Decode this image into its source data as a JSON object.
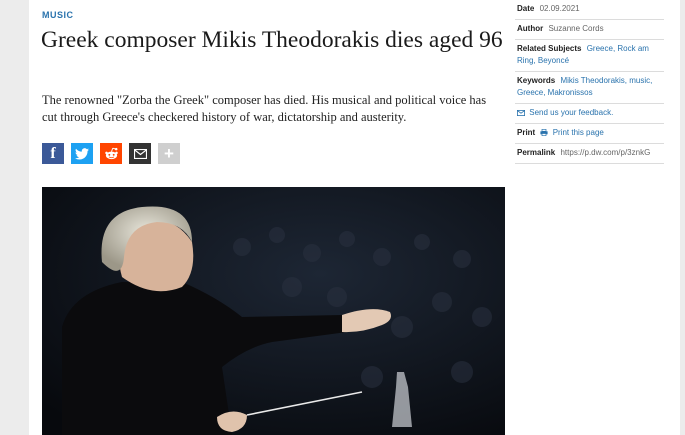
{
  "article": {
    "category": "MUSIC",
    "headline": "Greek composer Mikis Theodorakis dies aged 96",
    "teaser": "The renowned \"Zorba the Greek\" composer has died. His musical and political voice has cut through Greece's checkered history of war, dictatorship and austerity."
  },
  "share": [
    {
      "name": "facebook",
      "glyph": "f",
      "color": "#3b5998"
    },
    {
      "name": "twitter",
      "glyph": "",
      "color": "#1da1f2"
    },
    {
      "name": "reddit",
      "glyph": "",
      "color": "#ff4500"
    },
    {
      "name": "email",
      "glyph": "",
      "color": "#333333"
    },
    {
      "name": "more",
      "glyph": "+",
      "color": "#cfcfcf"
    }
  ],
  "sidebar": {
    "date_label": "Date",
    "date_value": "02.09.2021",
    "author_label": "Author",
    "author_value": "Suzanne Cords",
    "subjects_label": "Related Subjects",
    "subjects_links": "Greece, Rock am Ring, Beyoncé",
    "keywords_label": "Keywords",
    "keywords_links": "Mikis Theodorakis, music, Greece, Makronissos",
    "feedback_text": "Send us your feedback.",
    "print_label": "Print",
    "print_link": "Print this page",
    "permalink_label": "Permalink",
    "permalink_value": "https://p.dw.com/p/3znkG"
  },
  "colors": {
    "accent": "#2a73ad",
    "background": "#ececec"
  }
}
